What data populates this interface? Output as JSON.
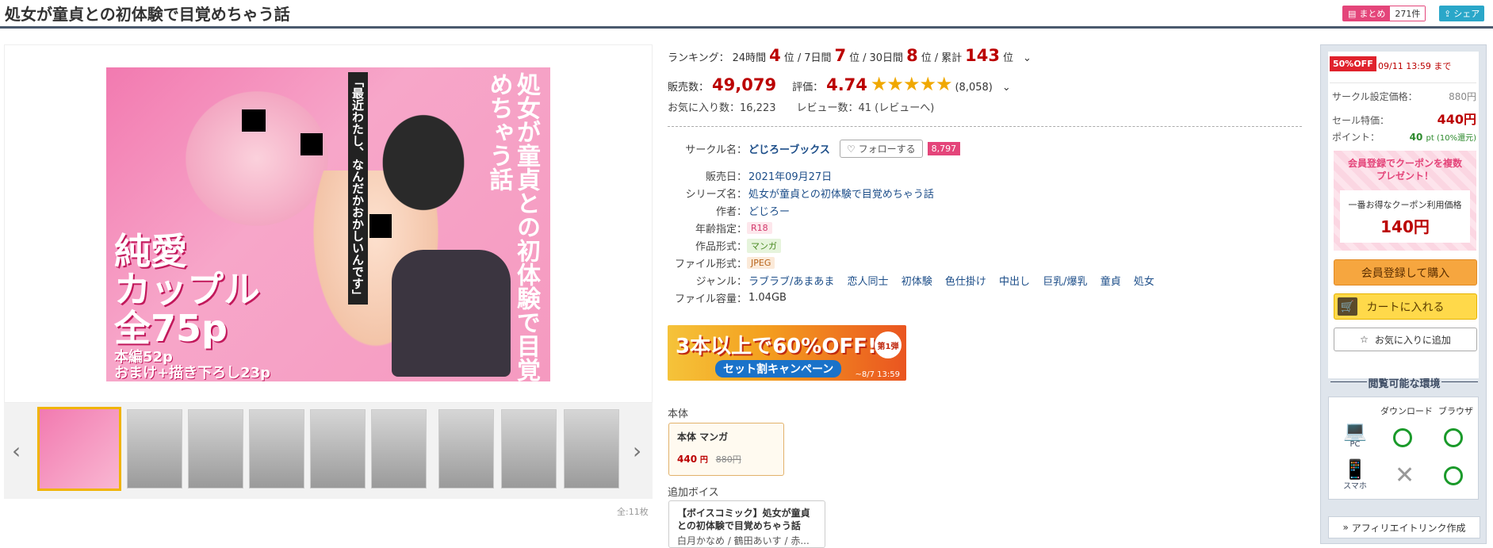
{
  "header": {
    "title": "処女が童貞との初体験で目覚めちゃう話",
    "matome_label": "まとめ",
    "matome_count": "271件",
    "share_label": "シェア"
  },
  "cover": {
    "title_vertical": "処女が童貞との初体験で目覚めちゃう話",
    "quote": "「最近わたし、なんだかおかしいんです」",
    "big_text": "純愛\nカップル\n全75p",
    "small_text": "本編52p\nおまけ+描き下ろし23p"
  },
  "thumbs": {
    "total": "全:11枚"
  },
  "ranking": {
    "label": "ランキング：",
    "day_label": "24時間",
    "day": "4",
    "day_unit": "位",
    "week_label": "7日間",
    "week": "7",
    "week_unit": "位",
    "month_label": "30日間",
    "month": "8",
    "month_unit": "位",
    "total_label": "累計",
    "total": "143",
    "total_unit": "位",
    "sep": "/",
    "chevron": "⌄"
  },
  "sales": {
    "label": "販売数：",
    "value": "49,079",
    "rating_label": "評価：",
    "rating": "4.74",
    "stars": "★★★★★",
    "rating_count": "(8,058)"
  },
  "fav": {
    "text": "お気に入り数：16,223　　レビュー数：41 (レビューへ)"
  },
  "spec": {
    "circle_label": "サークル名：",
    "circle": "どじろーブックス",
    "follow": "フォローする",
    "follow_count": "8,797",
    "date_label": "販売日：",
    "date": "2021年09月27日",
    "series_label": "シリーズ名：",
    "series": "処女が童貞との初体験で目覚めちゃう話",
    "author_label": "作者：",
    "author": "どじろー",
    "age_label": "年齢指定：",
    "age": "R18",
    "format_label": "作品形式：",
    "format": "マンガ",
    "file_label": "ファイル形式：",
    "file": "JPEG",
    "genre_label": "ジャンル：",
    "genres": [
      "ラブラブ/あまあま",
      "恋人同士",
      "初体験",
      "色仕掛け",
      "中出し",
      "巨乳/爆乳",
      "童貞",
      "処女"
    ],
    "size_label": "ファイル容量：",
    "size": "1.04GB"
  },
  "banner": {
    "main": "3本以上で60%OFF!",
    "sub": "セット割キャンペーン",
    "round": "第1弾",
    "date": "~8/7 13:59"
  },
  "honbun": {
    "label": "本体",
    "title": "本体 マンガ",
    "price": "440",
    "price_unit": "円",
    "old": "880円"
  },
  "voice": {
    "label": "追加ボイス",
    "title": "【ボイスコミック】処女が童貞との初体験で目覚めちゃう話",
    "sub": "白月かなめ / 鶴田あいす / 赤..."
  },
  "side": {
    "sale_badge": "50%OFF",
    "sale_until": "09/11 13:59 まで",
    "list_label": "サークル設定価格：",
    "list_price": "880円",
    "sale_label": "セール特価：",
    "sale_price": "440円",
    "point_label": "ポイント：",
    "point": "40",
    "point_unit": "pt (10%還元)",
    "coupon_head": "会員登録でクーポンを複数\nプレゼント！",
    "coupon_caption": "一番お得なクーポン利用価格",
    "coupon_price": "140円",
    "buy": "会員登録して購入",
    "cart": "カートに入れる",
    "fav": "お気に入りに追加",
    "env_title": "閲覧可能な環境",
    "env_download": "ダウンロード",
    "env_browser": "ブラウザ",
    "env_pc": "PC",
    "env_phone": "スマホ",
    "affil": "アフィリエイトリンク作成"
  },
  "colors": {
    "accent": "#e4457a",
    "price": "#b00000",
    "star": "#f0a800",
    "link": "#1d4e89"
  }
}
